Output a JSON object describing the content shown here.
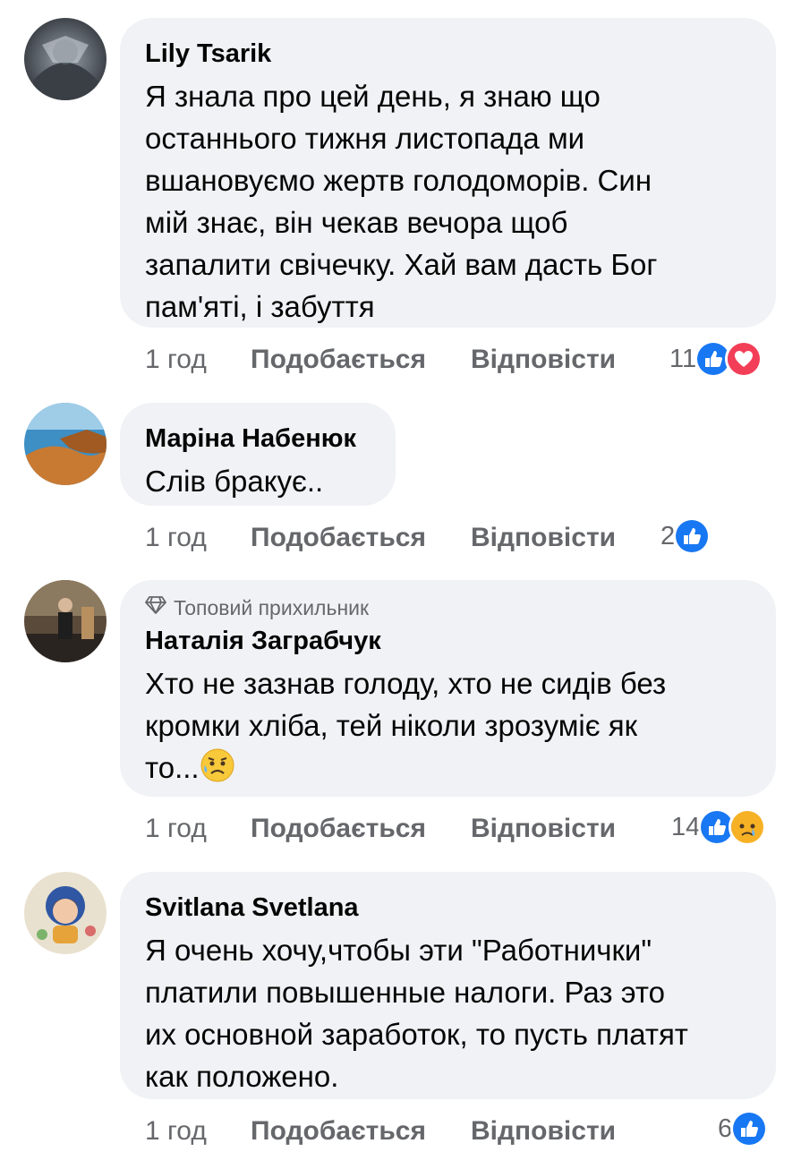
{
  "comments": [
    {
      "author": "Lily Tsarik",
      "lines": [
        "Я знала про цей день, я знаю що",
        "останнього тижня листопада ми",
        "вшановуємо жертв голодоморів. Син",
        "мій знає, він чекав вечора щоб",
        "запалити свічечку. Хай вам дасть Бог",
        "пам'яті, і забуття"
      ],
      "time": "1 год",
      "like_label": "Подобається",
      "reply_label": "Відповісти",
      "reaction_count": "11",
      "reactions": [
        "like-icon",
        "love-icon"
      ]
    },
    {
      "author": "Маріна Набенюк",
      "lines": [
        "Слів бракує.."
      ],
      "time": "1 год",
      "like_label": "Подобається",
      "reply_label": "Відповісти",
      "reaction_count": "2",
      "reactions": [
        "like-icon"
      ]
    },
    {
      "badge": "Топовий прихильник",
      "author": "Наталія Заграбчук",
      "lines": [
        "Хто не зазнав голоду, хто не сидів без",
        "кромки хліба, тей ніколи  зрозуміє як",
        "то..."
      ],
      "time": "1 год",
      "like_label": "Подобається",
      "reply_label": "Відповісти",
      "reaction_count": "14",
      "reactions": [
        "like-icon",
        "sad-icon"
      ]
    },
    {
      "author": "Svitlana Svetlana",
      "lines": [
        "Я очень хочу,чтобы эти \"Работнички\"",
        "платили повышенные налоги.  Раз это",
        "их основной заработок, то пусть платят",
        "как положено."
      ],
      "time": "1 год",
      "like_label": "Подобається",
      "reply_label": "Відповісти",
      "reaction_count": "6",
      "reactions": [
        "like-icon"
      ]
    }
  ],
  "colors": {
    "bubble": "#f0f2f5",
    "meta_text": "#65676b",
    "like_blue": "#1877f2",
    "love_red": "#f33e58",
    "sad_yellow": "#f7b125"
  }
}
